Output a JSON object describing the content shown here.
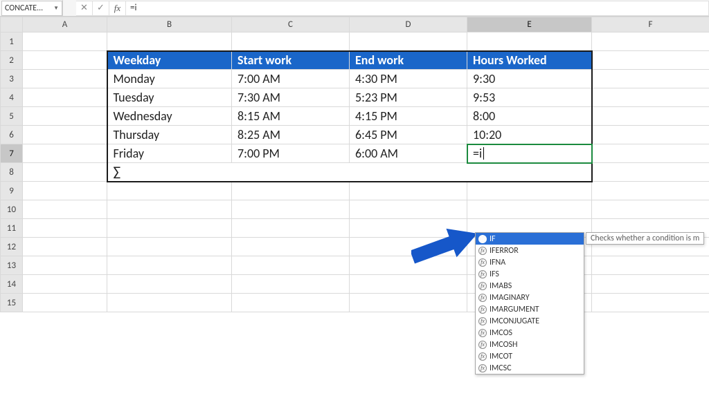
{
  "formula_bar": {
    "name_box": "CONCATE...",
    "cancel_glyph": "✕",
    "confirm_glyph": "✓",
    "fx_glyph": "fx",
    "formula_text": "=i"
  },
  "columns": [
    "A",
    "B",
    "C",
    "D",
    "E",
    "F"
  ],
  "rows": [
    "1",
    "2",
    "3",
    "4",
    "5",
    "6",
    "7",
    "8",
    "9",
    "10",
    "11",
    "12",
    "13",
    "14",
    "15"
  ],
  "active_col": "E",
  "active_row": "7",
  "table": {
    "headers": {
      "weekday": "Weekday",
      "start": "Start work",
      "end": "End work",
      "hours": "Hours Worked"
    },
    "rows": [
      {
        "weekday": "Monday",
        "start": "7:00 AM",
        "end": "4:30 PM",
        "hours": "9:30"
      },
      {
        "weekday": "Tuesday",
        "start": "7:30 AM",
        "end": "5:23 PM",
        "hours": "9:53"
      },
      {
        "weekday": "Wednesday",
        "start": "8:15 AM",
        "end": "4:15 PM",
        "hours": "8:00"
      },
      {
        "weekday": "Thursday",
        "start": "8:25 AM",
        "end": "6:45 PM",
        "hours": "10:20"
      },
      {
        "weekday": "Friday",
        "start": "7:00 PM",
        "end": "6:00 AM",
        "hours": "=i"
      }
    ],
    "sigma": "∑"
  },
  "autocomplete": {
    "items": [
      "IF",
      "IFERROR",
      "IFNA",
      "IFS",
      "IMABS",
      "IMAGINARY",
      "IMARGUMENT",
      "IMCONJUGATE",
      "IMCOS",
      "IMCOSH",
      "IMCOT",
      "IMCSC"
    ],
    "selected": 0,
    "tooltip": "Checks whether a condition is m"
  }
}
